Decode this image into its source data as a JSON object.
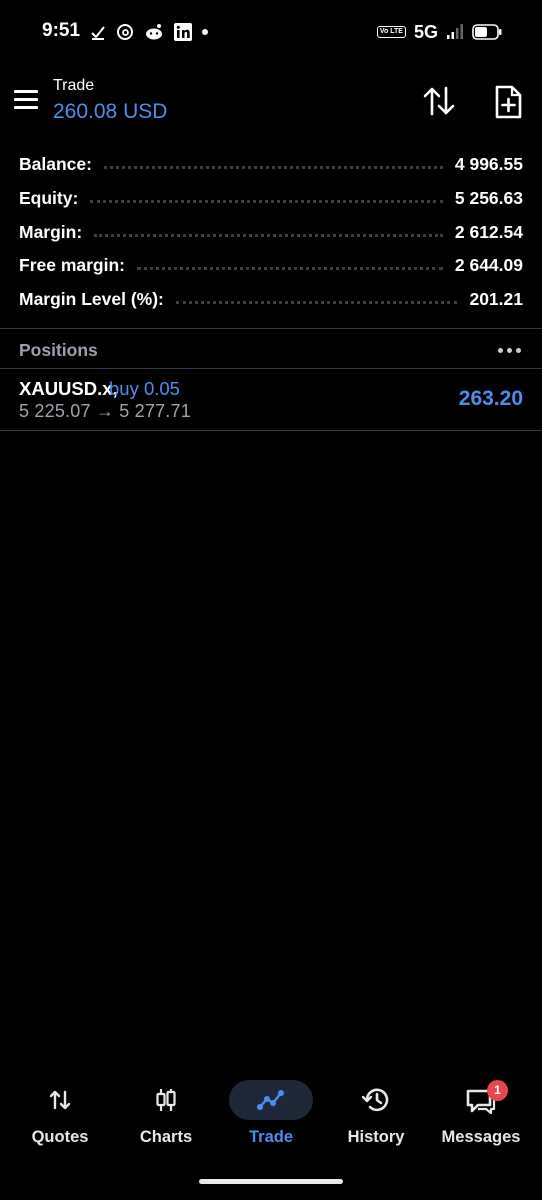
{
  "status_bar": {
    "time": "9:51",
    "network": "5G",
    "volte_label": "Vo LTE",
    "left_icons": [
      "check-icon",
      "threads-icon",
      "reddit-icon",
      "linkedin-icon",
      "dot-icon"
    ],
    "right_icons": [
      "volte-icon",
      "signal-icon",
      "battery-icon"
    ]
  },
  "header": {
    "title": "Trade",
    "subtitle": "260.08 USD",
    "menu_icon": "hamburger-menu-icon",
    "actions": [
      "sort-icon",
      "new-order-icon"
    ]
  },
  "summary": [
    {
      "label": "Balance:",
      "value": "4 996.55"
    },
    {
      "label": "Equity:",
      "value": "5 256.63"
    },
    {
      "label": "Margin:",
      "value": "2 612.54"
    },
    {
      "label": "Free margin:",
      "value": "2 644.09"
    },
    {
      "label": "Margin Level (%):",
      "value": "201.21"
    }
  ],
  "positions": {
    "title": "Positions",
    "items": [
      {
        "symbol": "XAUUSD.x,",
        "side": "buy 0.05",
        "prices": "5 225.07 → 5 277.71",
        "profit": "263.20"
      }
    ]
  },
  "bottom_nav": {
    "items": [
      {
        "label": "Quotes",
        "icon": "quotes-arrows-icon"
      },
      {
        "label": "Charts",
        "icon": "candlestick-icon"
      },
      {
        "label": "Trade",
        "icon": "trade-line-icon"
      },
      {
        "label": "History",
        "icon": "history-clock-icon"
      },
      {
        "label": "Messages",
        "icon": "messages-icon",
        "badge": "1"
      }
    ],
    "active": "Trade"
  },
  "colors": {
    "background": "#000000",
    "accent": "#4a8fec",
    "muted_text": "#a0a4ad",
    "divider": "#34384a",
    "badge": "#e5484d"
  }
}
